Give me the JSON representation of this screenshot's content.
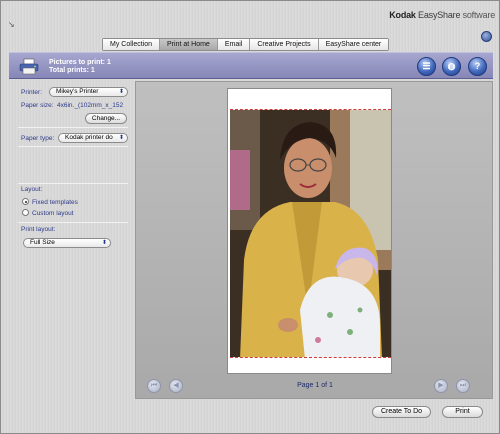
{
  "app": {
    "brand_bold": "Kodak",
    "brand_mid": " EasyShare",
    "brand_light": " software"
  },
  "tabs": [
    {
      "label": "My Collection",
      "active": false
    },
    {
      "label": "Print at Home",
      "active": true
    },
    {
      "label": "Email",
      "active": false
    },
    {
      "label": "Creative Projects",
      "active": false
    },
    {
      "label": "EasyShare center",
      "active": false
    }
  ],
  "banner": {
    "pictures_to_print": "Pictures to print: 1",
    "total_prints": "Total prints: 1",
    "buttons": [
      {
        "icon": "list-icon",
        "glyph": "☰"
      },
      {
        "icon": "globe-icon",
        "glyph": "◍"
      },
      {
        "icon": "help-icon",
        "glyph": "?"
      }
    ]
  },
  "left_panel": {
    "printer_label": "Printer:",
    "printer_value": "Mikey's Printer",
    "paper_size_label": "Paper size:",
    "paper_size_value": "4x6in._(102mm_x_152",
    "change_button": "Change...",
    "paper_type_label": "Paper type:",
    "paper_type_value": "Kodak printer do",
    "layout_label": "Layout:",
    "layout_options": [
      {
        "label": "Fixed templates",
        "selected": true
      },
      {
        "label": "Custom layout",
        "selected": false
      }
    ],
    "print_layout_label": "Print layout:",
    "print_layout_value": "Full Size"
  },
  "preview": {
    "page_text": "Page 1 of 1"
  },
  "footer": {
    "create_to_do": "Create To Do",
    "print": "Print"
  },
  "colors": {
    "banner": "#9696c4",
    "label_text": "#2e3a8a",
    "accent_blue": "#3458b0"
  }
}
